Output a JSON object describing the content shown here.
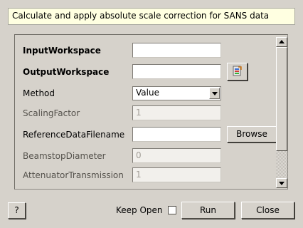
{
  "description": "Calculate and apply absolute scale correction for SANS data",
  "properties": [
    {
      "label": "InputWorkspace",
      "value": ""
    },
    {
      "label": "OutputWorkspace",
      "value": ""
    },
    {
      "label": "Method",
      "value": "Value"
    },
    {
      "label": "ScalingFactor",
      "value": "1"
    },
    {
      "label": "ReferenceDataFilename",
      "value": ""
    },
    {
      "label": "BeamstopDiameter",
      "value": "0"
    },
    {
      "label": "AttenuatorTransmission",
      "value": "1"
    }
  ],
  "browse_label": "Browse",
  "file_icon": "workspace-picker-icon",
  "help_label": "?",
  "keep_open_label": "Keep Open",
  "keep_open_checked": false,
  "run_label": "Run",
  "close_label": "Close",
  "colors": {
    "description_bg": "#ffffe1",
    "window_bg": "#d6d2cb"
  }
}
